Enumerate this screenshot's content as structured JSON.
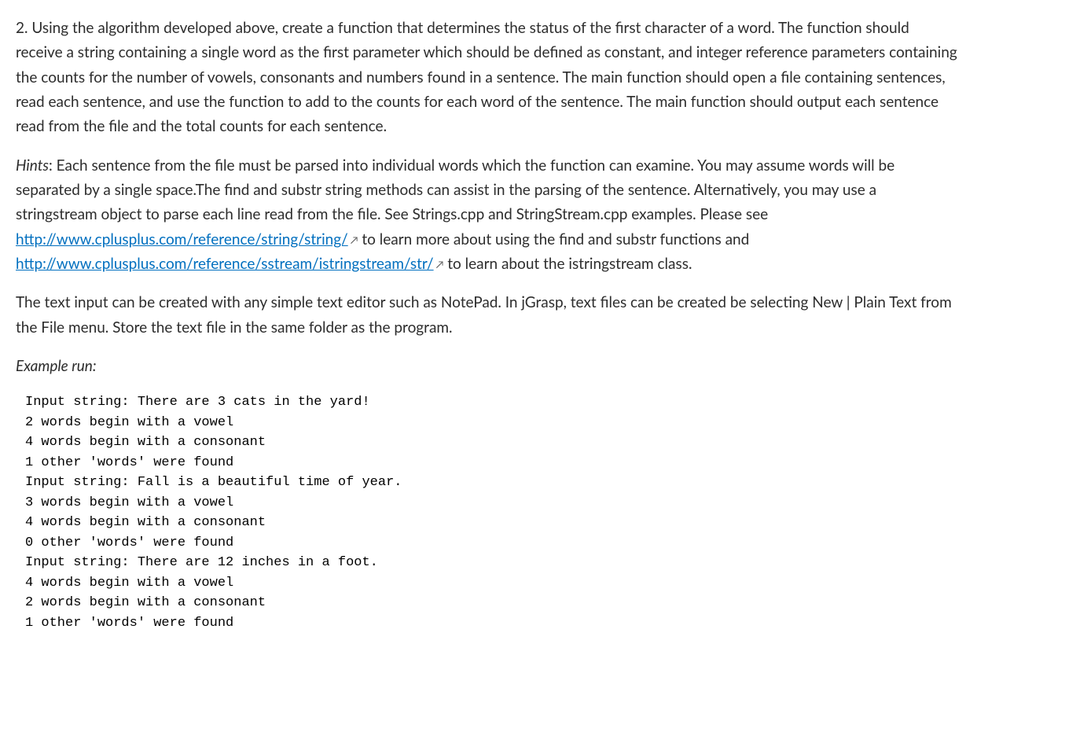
{
  "para1": "2. Using the algorithm developed above, create a function that determines the status of the first character of a word.  The function should receive a string containing a single word as the first parameter which should be defined as constant, and integer reference parameters containing the counts for the number of vowels, consonants and numbers found in a sentence.  The main function should open a file containing sentences, read each sentence, and use the function to add to the counts for each word of the sentence.  The main function should output each sentence read from the file and the total counts for each sentence.",
  "para2": {
    "hints_label": "Hints",
    "segment1": ": Each sentence from the file must be parsed into individual words which the function can examine.  You may assume words will be separated by a single space.The find and substr string methods can assist in the parsing of the sentence.  Alternatively, you may use a stringstream object to parse each line read from the file.  See Strings.cpp and StringStream.cpp examples.  Please see ",
    "link1_text": "http://www.cplusplus.com/reference/string/string/",
    "segment2": "  to learn more about using the find and substr functions and ",
    "link2_text": "http://www.cplusplus.com/reference/sstream/istringstream/str/",
    "segment3": "  to learn about the istringstream class."
  },
  "para3": "The text input can be created with any simple text editor such as NotePad.  In jGrasp, text files can be created be selecting New | Plain Text from the File menu.  Store the text file in the same folder as the program.",
  "example_label": "Example run:",
  "example_output": "Input string: There are 3 cats in the yard!\n2 words begin with a vowel\n4 words begin with a consonant\n1 other 'words' were found\nInput string: Fall is a beautiful time of year.\n3 words begin with a vowel\n4 words begin with a consonant\n0 other 'words' were found\nInput string: There are 12 inches in a foot.\n4 words begin with a vowel\n2 words begin with a consonant\n1 other 'words' were found"
}
